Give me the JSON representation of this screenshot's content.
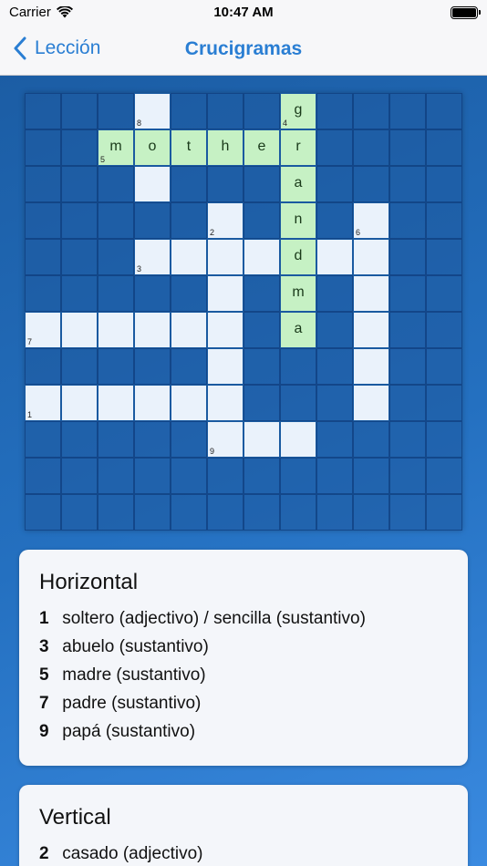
{
  "status": {
    "carrier": "Carrier",
    "time": "10:47 AM"
  },
  "nav": {
    "back_label": "Lección",
    "title": "Crucigramas"
  },
  "horizontal": {
    "title": "Horizontal",
    "clues": [
      {
        "n": "1",
        "text": "soltero (adjectivo) / sencilla (sustantivo)"
      },
      {
        "n": "3",
        "text": "abuelo (sustantivo)"
      },
      {
        "n": "5",
        "text": "madre (sustantivo)"
      },
      {
        "n": "7",
        "text": "padre (sustantivo)"
      },
      {
        "n": "9",
        "text": "papá (sustantivo)"
      }
    ]
  },
  "vertical": {
    "title": "Vertical",
    "clues": [
      {
        "n": "2",
        "text": "casado (adjectivo)"
      }
    ]
  },
  "crossword": {
    "rows": 12,
    "cols": 12,
    "cells": [
      {
        "r": 0,
        "c": 3,
        "num": "8"
      },
      {
        "r": 0,
        "c": 7,
        "num": "4",
        "letter": "g"
      },
      {
        "r": 1,
        "c": 2,
        "num": "5",
        "letter": "m"
      },
      {
        "r": 1,
        "c": 3,
        "letter": "o"
      },
      {
        "r": 1,
        "c": 4,
        "letter": "t"
      },
      {
        "r": 1,
        "c": 5,
        "letter": "h"
      },
      {
        "r": 1,
        "c": 6,
        "letter": "e"
      },
      {
        "r": 1,
        "c": 7,
        "letter": "r"
      },
      {
        "r": 2,
        "c": 3
      },
      {
        "r": 2,
        "c": 7,
        "letter": "a"
      },
      {
        "r": 3,
        "c": 5,
        "num": "2"
      },
      {
        "r": 3,
        "c": 7,
        "letter": "n"
      },
      {
        "r": 3,
        "c": 9,
        "num": "6"
      },
      {
        "r": 4,
        "c": 3,
        "num": "3"
      },
      {
        "r": 4,
        "c": 4
      },
      {
        "r": 4,
        "c": 5
      },
      {
        "r": 4,
        "c": 6
      },
      {
        "r": 4,
        "c": 7,
        "letter": "d"
      },
      {
        "r": 4,
        "c": 8
      },
      {
        "r": 4,
        "c": 9
      },
      {
        "r": 5,
        "c": 5
      },
      {
        "r": 5,
        "c": 7,
        "letter": "m"
      },
      {
        "r": 5,
        "c": 9
      },
      {
        "r": 6,
        "c": 0,
        "num": "7"
      },
      {
        "r": 6,
        "c": 1
      },
      {
        "r": 6,
        "c": 2
      },
      {
        "r": 6,
        "c": 3
      },
      {
        "r": 6,
        "c": 4
      },
      {
        "r": 6,
        "c": 5
      },
      {
        "r": 6,
        "c": 7,
        "letter": "a"
      },
      {
        "r": 6,
        "c": 9
      },
      {
        "r": 7,
        "c": 5
      },
      {
        "r": 7,
        "c": 9
      },
      {
        "r": 8,
        "c": 0,
        "num": "1"
      },
      {
        "r": 8,
        "c": 1
      },
      {
        "r": 8,
        "c": 2
      },
      {
        "r": 8,
        "c": 3
      },
      {
        "r": 8,
        "c": 4
      },
      {
        "r": 8,
        "c": 5
      },
      {
        "r": 8,
        "c": 9
      },
      {
        "r": 9,
        "c": 5,
        "num": "9"
      },
      {
        "r": 9,
        "c": 6
      },
      {
        "r": 9,
        "c": 7
      }
    ]
  }
}
